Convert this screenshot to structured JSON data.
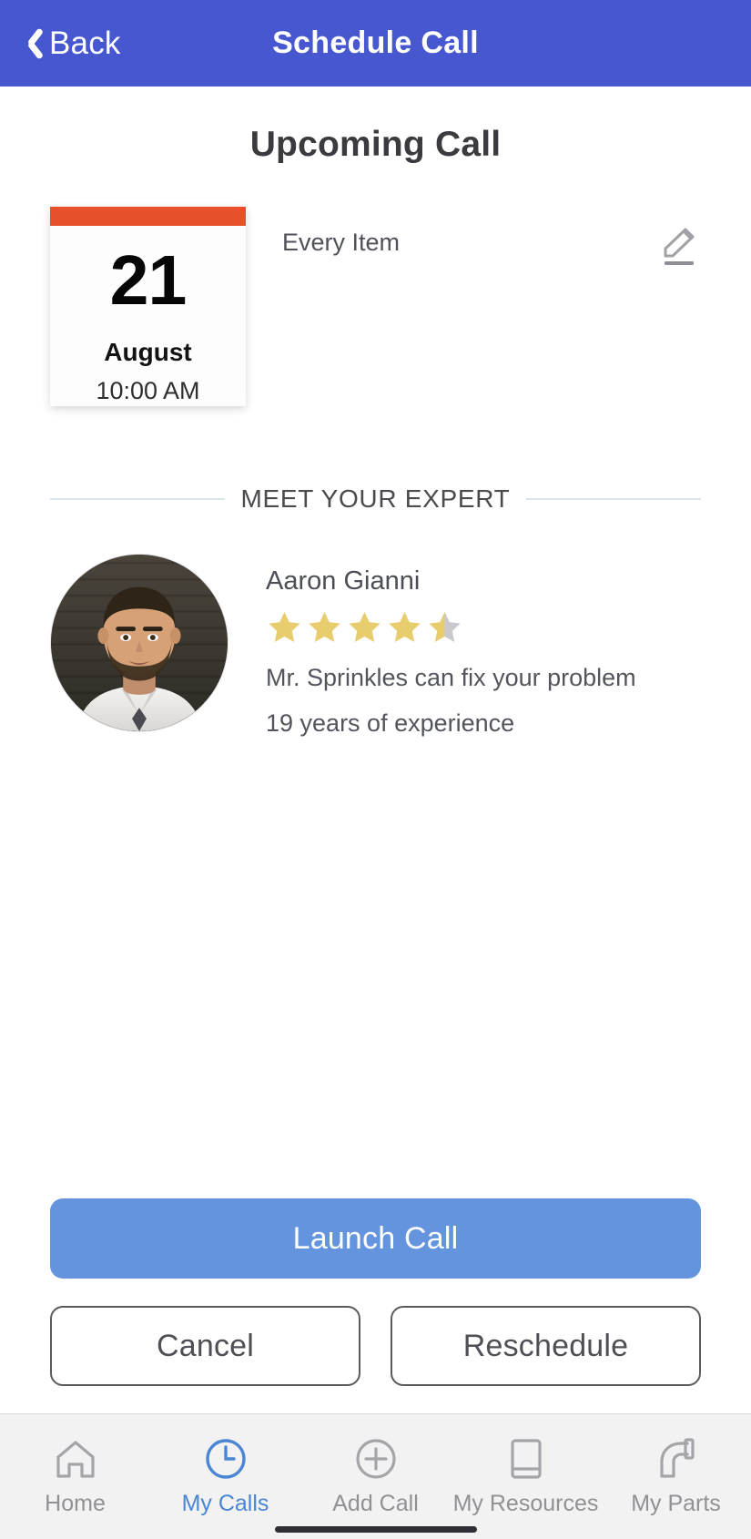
{
  "navbar": {
    "back_label": "Back",
    "title": "Schedule Call",
    "back_icon": "chevron-left-icon",
    "bg_color": "#4657cf"
  },
  "page": {
    "title": "Upcoming Call"
  },
  "appointment": {
    "day": "21",
    "month": "August",
    "time": "10:00 AM",
    "item_label": "Every Item",
    "edit_icon": "pencil-edit-icon",
    "strip_color": "#e8502c"
  },
  "expert_section": {
    "divider_label": "MEET YOUR EXPERT",
    "name": "Aaron Gianni",
    "rating": 4.5,
    "rating_max": 5,
    "tagline": "Mr. Sprinkles can fix your problem",
    "experience": "19 years of experience",
    "avatar_alt": "avatar",
    "star_color": "#e8cd6f",
    "star_empty_color": "#c9c9cd"
  },
  "actions": {
    "launch_label": "Launch Call",
    "cancel_label": "Cancel",
    "reschedule_label": "Reschedule",
    "primary_color": "#6494dd"
  },
  "tabbar": {
    "active_color": "#4a86d4",
    "inactive_color": "#919195",
    "items": [
      {
        "label": "Home",
        "icon": "home-icon",
        "active": false
      },
      {
        "label": "My Calls",
        "icon": "clock-icon",
        "active": true
      },
      {
        "label": "Add Call",
        "icon": "plus-circle-icon",
        "active": false
      },
      {
        "label": "My Resources",
        "icon": "book-icon",
        "active": false
      },
      {
        "label": "My Parts",
        "icon": "pipe-icon",
        "active": false
      }
    ]
  }
}
